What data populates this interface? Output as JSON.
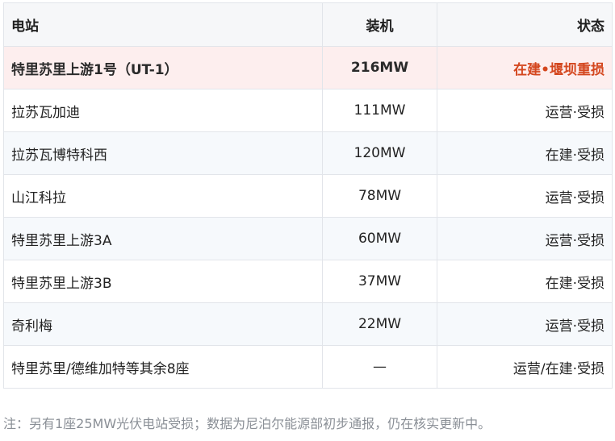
{
  "table": {
    "headers": {
      "station": "电站",
      "capacity": "装机",
      "status": "状态"
    },
    "highlight_row": {
      "station": "特里苏里上游1号（UT-1）",
      "capacity": "216MW",
      "status": "在建•堰坝重损"
    },
    "rows": [
      {
        "station": "拉苏瓦加迪",
        "capacity": "111MW",
        "status": "运营·受损"
      },
      {
        "station": "拉苏瓦博特科西",
        "capacity": "120MW",
        "status": "在建·受损"
      },
      {
        "station": "山江科拉",
        "capacity": "78MW",
        "status": "运营·受损"
      },
      {
        "station": "特里苏里上游3A",
        "capacity": "60MW",
        "status": "运营·受损"
      },
      {
        "station": "特里苏里上游3B",
        "capacity": "37MW",
        "status": "在建·受损"
      },
      {
        "station": "奇利梅",
        "capacity": "22MW",
        "status": "运营·受损"
      },
      {
        "station": "特里苏里/德维加特等其余8座",
        "capacity": "—",
        "status": "运营/在建·受损"
      }
    ]
  },
  "note": "注：另有1座25MW光伏电站受损；数据为尼泊尔能源部初步通报，仍在核实更新中。",
  "colors": {
    "highlight_bg": "#fdeeee",
    "highlight_status": "#d4471f",
    "header_bg": "#f6f7f9",
    "zebra_bg": "#f6f9fc",
    "border": "#e2e5ea",
    "note_text": "#8a8f96"
  }
}
